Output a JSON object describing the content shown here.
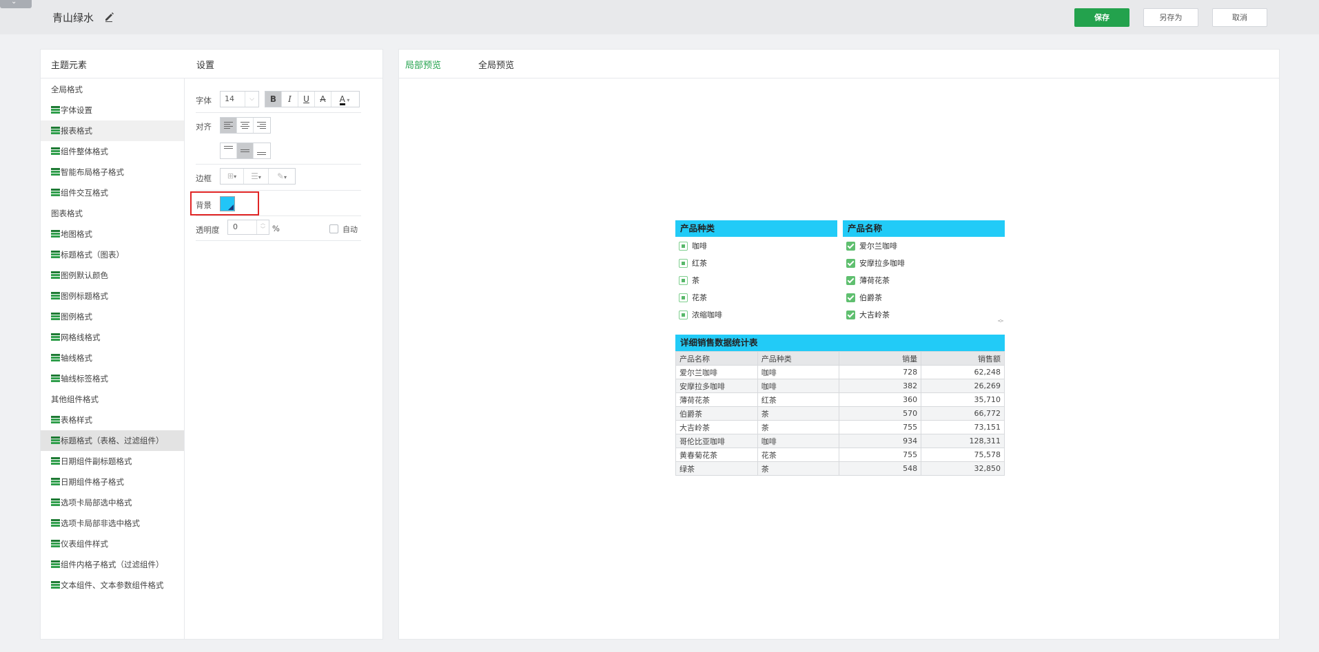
{
  "header": {
    "title": "青山绿水",
    "save_label": "保存",
    "save_as_label": "另存为",
    "cancel_label": "取消"
  },
  "left": {
    "elements_heading": "主题元素",
    "settings_heading": "设置",
    "tree": [
      {
        "type": "group",
        "label": "全局格式"
      },
      {
        "type": "item",
        "label": "字体设置"
      },
      {
        "type": "item",
        "label": "报表格式",
        "selected": true
      },
      {
        "type": "item",
        "label": "组件整体格式"
      },
      {
        "type": "item",
        "label": "智能布局格子格式"
      },
      {
        "type": "item",
        "label": "组件交互格式"
      },
      {
        "type": "group",
        "label": "图表格式"
      },
      {
        "type": "item",
        "label": "地图格式"
      },
      {
        "type": "item",
        "label": "标题格式（图表）"
      },
      {
        "type": "item",
        "label": "图例默认颜色"
      },
      {
        "type": "item",
        "label": "图例标题格式"
      },
      {
        "type": "item",
        "label": "图例格式"
      },
      {
        "type": "item",
        "label": "网格线格式"
      },
      {
        "type": "item",
        "label": "轴线格式"
      },
      {
        "type": "item",
        "label": "轴线标签格式"
      },
      {
        "type": "group",
        "label": "其他组件格式"
      },
      {
        "type": "item",
        "label": "表格样式"
      },
      {
        "type": "item",
        "label": "标题格式（表格、过滤组件）",
        "active": true
      },
      {
        "type": "item",
        "label": "日期组件副标题格式"
      },
      {
        "type": "item",
        "label": "日期组件格子格式"
      },
      {
        "type": "item",
        "label": "选项卡局部选中格式"
      },
      {
        "type": "item",
        "label": "选项卡局部非选中格式"
      },
      {
        "type": "item",
        "label": "仪表组件样式"
      },
      {
        "type": "item",
        "label": "组件内格子格式（过滤组件）"
      },
      {
        "type": "item",
        "label": "文本组件、文本参数组件格式"
      }
    ]
  },
  "settings": {
    "font_label": "字体",
    "font_size": "14",
    "bold": "B",
    "italic": "I",
    "underline": "U",
    "strike": "A",
    "font_color": "A",
    "align_label": "对齐",
    "border_label": "边框",
    "background_label": "背景",
    "background_color": "#22c5f7",
    "opacity_label": "透明度",
    "opacity_value": "0",
    "opacity_unit": "%",
    "auto_label": "自动"
  },
  "preview": {
    "tab_local": "局部预览",
    "tab_global": "全局预览",
    "filter1": {
      "title": "产品种类",
      "items": [
        "咖啡",
        "红茶",
        "茶",
        "花茶",
        "浓缩咖啡"
      ]
    },
    "filter2": {
      "title": "产品名称",
      "items": [
        "爱尔兰咖啡",
        "安摩拉多咖啡",
        "薄荷花茶",
        "伯爵茶",
        "大吉岭茶"
      ]
    },
    "table": {
      "title": "详细销售数据统计表",
      "columns": [
        "产品名称",
        "产品种类",
        "销量",
        "销售额"
      ],
      "rows": [
        [
          "爱尔兰咖啡",
          "咖啡",
          "728",
          "62,248"
        ],
        [
          "安摩拉多咖啡",
          "咖啡",
          "382",
          "26,269"
        ],
        [
          "薄荷花茶",
          "红茶",
          "360",
          "35,710"
        ],
        [
          "伯爵茶",
          "茶",
          "570",
          "66,772"
        ],
        [
          "大吉岭茶",
          "茶",
          "755",
          "73,151"
        ],
        [
          "哥伦比亚咖啡",
          "咖啡",
          "934",
          "128,311"
        ],
        [
          "黄春菊花茶",
          "花茶",
          "755",
          "75,578"
        ],
        [
          "绿茶",
          "茶",
          "548",
          "32,850"
        ]
      ]
    }
  }
}
